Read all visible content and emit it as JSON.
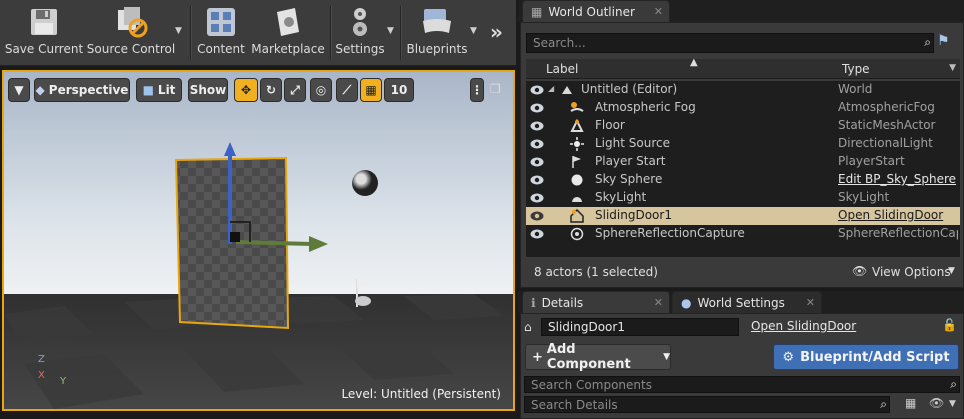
{
  "toolbar": {
    "items": [
      {
        "label": "Save Current",
        "icon": "floppy-disk-icon"
      },
      {
        "label": "Source Control",
        "icon": "source-control-icon"
      },
      {
        "label": "Content",
        "icon": "content-browser-icon"
      },
      {
        "label": "Marketplace",
        "icon": "marketplace-icon"
      },
      {
        "label": "Settings",
        "icon": "settings-gears-icon"
      },
      {
        "label": "Blueprints",
        "icon": "blueprints-controller-icon"
      }
    ],
    "more": "»"
  },
  "viewport": {
    "perspective_label": "Perspective",
    "lit_label": "Lit",
    "show_label": "Show",
    "grid_snap_value": "10",
    "level_label": "Level:  Untitled (Persistent)",
    "axis_z": "Z",
    "axis_x": "X",
    "axis_y": "Y",
    "selection_color": "#e8a60f"
  },
  "outliner": {
    "tab_title": "World Outliner",
    "search_placeholder": "Search...",
    "col_label": "Label",
    "col_type": "Type",
    "rows": [
      {
        "label": "Untitled (Editor)",
        "type": "World",
        "icon": "world-icon"
      },
      {
        "label": "Atmospheric Fog",
        "type": "AtmosphericFog",
        "icon": "fog-icon"
      },
      {
        "label": "Floor",
        "type": "StaticMeshActor",
        "icon": "static-mesh-icon"
      },
      {
        "label": "Light Source",
        "type": "DirectionalLight",
        "icon": "directional-light-icon"
      },
      {
        "label": "Player Start",
        "type": "PlayerStart",
        "icon": "player-start-icon"
      },
      {
        "label": "Sky Sphere",
        "type": "Edit BP_Sky_Sphere",
        "icon": "sphere-icon"
      },
      {
        "label": "SkyLight",
        "type": "SkyLight",
        "icon": "skylight-icon"
      },
      {
        "label": "SlidingDoor1",
        "type": "Open SlidingDoor",
        "icon": "actor-icon"
      },
      {
        "label": "SphereReflectionCapture",
        "type": "SphereReflectionCapt",
        "icon": "reflection-capture-icon"
      }
    ],
    "status": "8 actors (1 selected)",
    "view_options": "View Options"
  },
  "details": {
    "tab_title": "Details",
    "world_settings_tab": "World Settings",
    "actor_name": "SlidingDoor1",
    "open_link": "Open SlidingDoor",
    "add_component": "Add Component",
    "blueprint_script": "Blueprint/Add Script",
    "search_components_placeholder": "Search Components",
    "search_details_placeholder": "Search Details"
  }
}
